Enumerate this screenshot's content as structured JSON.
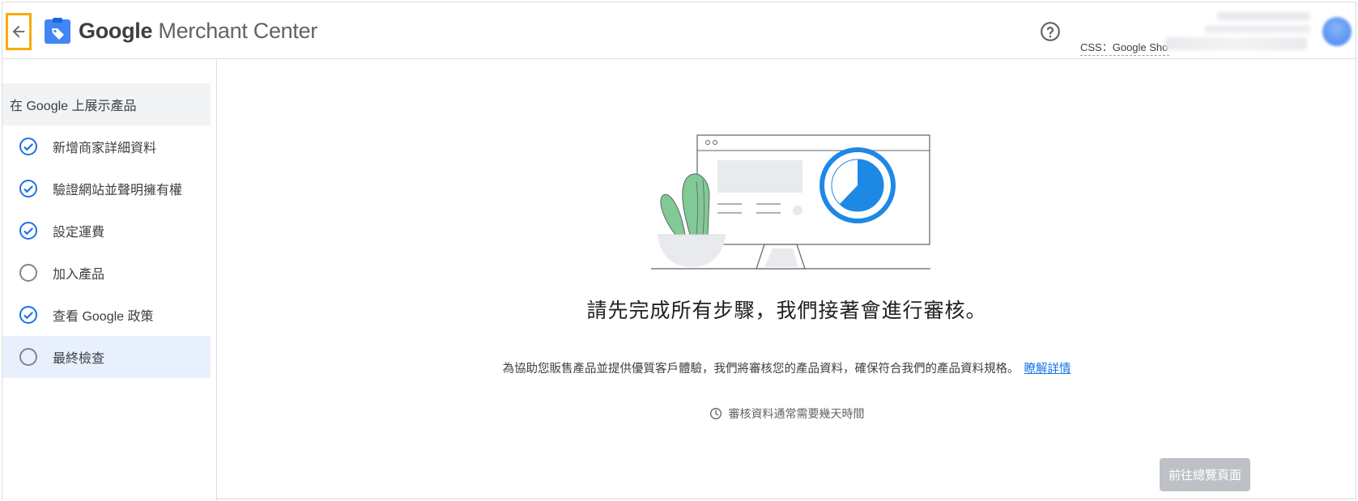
{
  "header": {
    "brand_google": "Google",
    "brand_product": " Merchant Center",
    "css_label": "CSS：Google Sho",
    "icons": {
      "back": "arrow-left-icon",
      "logo": "merchant-tag-icon",
      "help": "help-circle-icon",
      "avatar": "account-avatar"
    }
  },
  "sidebar": {
    "section_title": "在 Google 上展示產品",
    "steps": [
      {
        "label": "新增商家詳細資料",
        "done": true
      },
      {
        "label": "驗證網站並聲明擁有權",
        "done": true
      },
      {
        "label": "設定運費",
        "done": true
      },
      {
        "label": "加入產品",
        "done": false
      },
      {
        "label": "查看 Google 政策",
        "done": true
      },
      {
        "label": "最終檢查",
        "done": false,
        "active": true
      }
    ]
  },
  "main": {
    "headline": "請先完成所有步驟，我們接著會進行審核。",
    "description": "為協助您販售產品並提供優質客戶體驗，我們將審核您的產品資料，確保符合我們的產品資料規格。",
    "learn_more": "瞭解詳情",
    "note": "審核資料通常需要幾天時間",
    "cta_label": "前往總覽頁面"
  },
  "colors": {
    "accent": "#1a73e8",
    "highlight": "#f9ab00",
    "active_bg": "#e8f0fe",
    "disabled_button": "#bdc1c6",
    "illustration_blue": "#1e88e5",
    "cactus_green": "#81c995"
  }
}
